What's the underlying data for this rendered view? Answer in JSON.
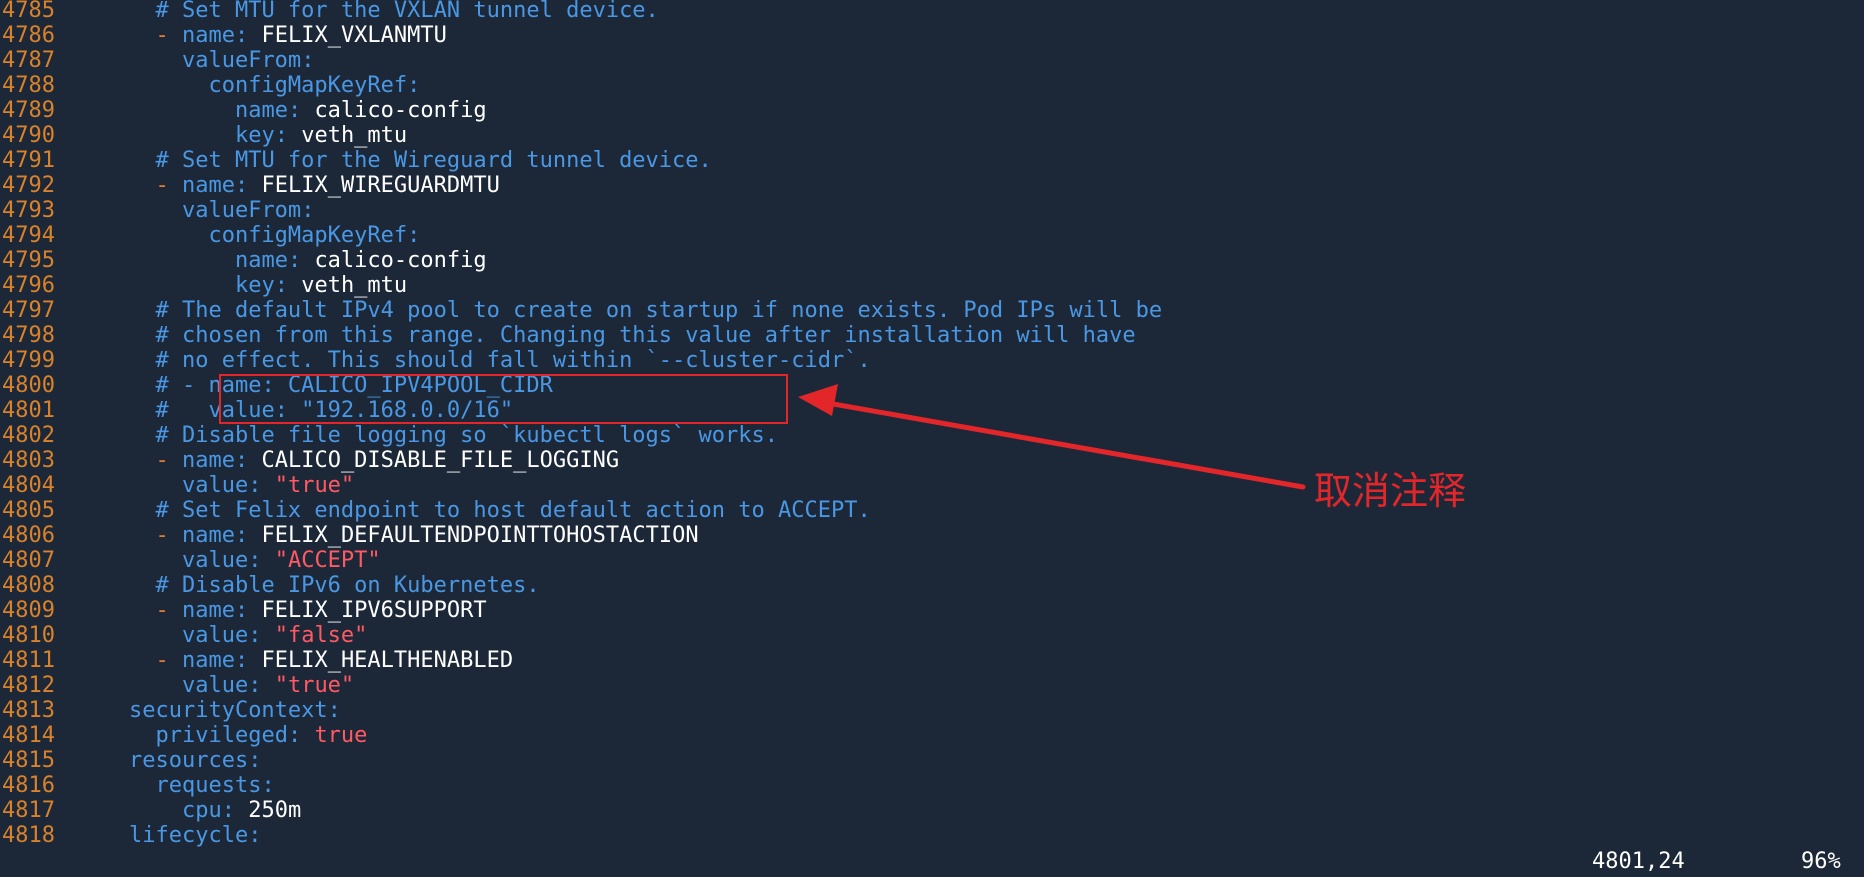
{
  "editor": {
    "lines": [
      {
        "num": "4785",
        "indent": "      ",
        "tokens": [
          {
            "t": "comment",
            "v": "# Set MTU for the VXLAN tunnel device."
          }
        ]
      },
      {
        "num": "4786",
        "indent": "      ",
        "tokens": [
          {
            "t": "dash",
            "v": "- "
          },
          {
            "t": "key",
            "v": "name"
          },
          {
            "t": "colon",
            "v": ": "
          },
          {
            "t": "plain",
            "v": "FELIX_VXLANMTU"
          }
        ]
      },
      {
        "num": "4787",
        "indent": "        ",
        "tokens": [
          {
            "t": "key",
            "v": "valueFrom"
          },
          {
            "t": "colon",
            "v": ":"
          }
        ]
      },
      {
        "num": "4788",
        "indent": "          ",
        "tokens": [
          {
            "t": "key",
            "v": "configMapKeyRef"
          },
          {
            "t": "colon",
            "v": ":"
          }
        ]
      },
      {
        "num": "4789",
        "indent": "            ",
        "tokens": [
          {
            "t": "key",
            "v": "name"
          },
          {
            "t": "colon",
            "v": ": "
          },
          {
            "t": "plain",
            "v": "calico-config"
          }
        ]
      },
      {
        "num": "4790",
        "indent": "            ",
        "tokens": [
          {
            "t": "key",
            "v": "key"
          },
          {
            "t": "colon",
            "v": ": "
          },
          {
            "t": "plain",
            "v": "veth_mtu"
          }
        ]
      },
      {
        "num": "4791",
        "indent": "      ",
        "tokens": [
          {
            "t": "comment",
            "v": "# Set MTU for the Wireguard tunnel device."
          }
        ]
      },
      {
        "num": "4792",
        "indent": "      ",
        "tokens": [
          {
            "t": "dash",
            "v": "- "
          },
          {
            "t": "key",
            "v": "name"
          },
          {
            "t": "colon",
            "v": ": "
          },
          {
            "t": "plain",
            "v": "FELIX_WIREGUARDMTU"
          }
        ]
      },
      {
        "num": "4793",
        "indent": "        ",
        "tokens": [
          {
            "t": "key",
            "v": "valueFrom"
          },
          {
            "t": "colon",
            "v": ":"
          }
        ]
      },
      {
        "num": "4794",
        "indent": "          ",
        "tokens": [
          {
            "t": "key",
            "v": "configMapKeyRef"
          },
          {
            "t": "colon",
            "v": ":"
          }
        ]
      },
      {
        "num": "4795",
        "indent": "            ",
        "tokens": [
          {
            "t": "key",
            "v": "name"
          },
          {
            "t": "colon",
            "v": ": "
          },
          {
            "t": "plain",
            "v": "calico-config"
          }
        ]
      },
      {
        "num": "4796",
        "indent": "            ",
        "tokens": [
          {
            "t": "key",
            "v": "key"
          },
          {
            "t": "colon",
            "v": ": "
          },
          {
            "t": "plain",
            "v": "veth_mtu"
          }
        ]
      },
      {
        "num": "4797",
        "indent": "      ",
        "tokens": [
          {
            "t": "comment",
            "v": "# The default IPv4 pool to create on startup if none exists. Pod IPs will be"
          }
        ]
      },
      {
        "num": "4798",
        "indent": "      ",
        "tokens": [
          {
            "t": "comment",
            "v": "# chosen from this range. Changing this value after installation will have"
          }
        ]
      },
      {
        "num": "4799",
        "indent": "      ",
        "tokens": [
          {
            "t": "comment",
            "v": "# no effect. This should fall within `--cluster-cidr`."
          }
        ]
      },
      {
        "num": "4800",
        "indent": "      ",
        "tokens": [
          {
            "t": "comment",
            "v": "# - name: CALICO_IPV4POOL_CIDR"
          }
        ]
      },
      {
        "num": "4801",
        "indent": "      ",
        "tokens": [
          {
            "t": "comment",
            "v": "#   value: \"192.168.0.0/16\""
          }
        ]
      },
      {
        "num": "4802",
        "indent": "      ",
        "tokens": [
          {
            "t": "comment",
            "v": "# Disable file logging so `kubectl logs` works."
          }
        ]
      },
      {
        "num": "4803",
        "indent": "      ",
        "tokens": [
          {
            "t": "dash",
            "v": "- "
          },
          {
            "t": "key",
            "v": "name"
          },
          {
            "t": "colon",
            "v": ": "
          },
          {
            "t": "plain",
            "v": "CALICO_DISABLE_FILE_LOGGING"
          }
        ]
      },
      {
        "num": "4804",
        "indent": "        ",
        "tokens": [
          {
            "t": "key",
            "v": "value"
          },
          {
            "t": "colon",
            "v": ": "
          },
          {
            "t": "string",
            "v": "\"true\""
          }
        ]
      },
      {
        "num": "4805",
        "indent": "      ",
        "tokens": [
          {
            "t": "comment",
            "v": "# Set Felix endpoint to host default action to ACCEPT."
          }
        ]
      },
      {
        "num": "4806",
        "indent": "      ",
        "tokens": [
          {
            "t": "dash",
            "v": "- "
          },
          {
            "t": "key",
            "v": "name"
          },
          {
            "t": "colon",
            "v": ": "
          },
          {
            "t": "plain",
            "v": "FELIX_DEFAULTENDPOINTTOHOSTACTION"
          }
        ]
      },
      {
        "num": "4807",
        "indent": "        ",
        "tokens": [
          {
            "t": "key",
            "v": "value"
          },
          {
            "t": "colon",
            "v": ": "
          },
          {
            "t": "string",
            "v": "\"ACCEPT\""
          }
        ]
      },
      {
        "num": "4808",
        "indent": "      ",
        "tokens": [
          {
            "t": "comment",
            "v": "# Disable IPv6 on Kubernetes."
          }
        ]
      },
      {
        "num": "4809",
        "indent": "      ",
        "tokens": [
          {
            "t": "dash",
            "v": "- "
          },
          {
            "t": "key",
            "v": "name"
          },
          {
            "t": "colon",
            "v": ": "
          },
          {
            "t": "plain",
            "v": "FELIX_IPV6SUPPORT"
          }
        ]
      },
      {
        "num": "4810",
        "indent": "        ",
        "tokens": [
          {
            "t": "key",
            "v": "value"
          },
          {
            "t": "colon",
            "v": ": "
          },
          {
            "t": "string",
            "v": "\"false\""
          }
        ]
      },
      {
        "num": "4811",
        "indent": "      ",
        "tokens": [
          {
            "t": "dash",
            "v": "- "
          },
          {
            "t": "key",
            "v": "name"
          },
          {
            "t": "colon",
            "v": ": "
          },
          {
            "t": "plain",
            "v": "FELIX_HEALTHENABLED"
          }
        ]
      },
      {
        "num": "4812",
        "indent": "        ",
        "tokens": [
          {
            "t": "key",
            "v": "value"
          },
          {
            "t": "colon",
            "v": ": "
          },
          {
            "t": "string",
            "v": "\"true\""
          }
        ]
      },
      {
        "num": "4813",
        "indent": "    ",
        "tokens": [
          {
            "t": "key",
            "v": "securityContext"
          },
          {
            "t": "colon",
            "v": ":"
          }
        ]
      },
      {
        "num": "4814",
        "indent": "      ",
        "tokens": [
          {
            "t": "key",
            "v": "privileged"
          },
          {
            "t": "colon",
            "v": ": "
          },
          {
            "t": "bool",
            "v": "true"
          }
        ]
      },
      {
        "num": "4815",
        "indent": "    ",
        "tokens": [
          {
            "t": "key",
            "v": "resources"
          },
          {
            "t": "colon",
            "v": ":"
          }
        ]
      },
      {
        "num": "4816",
        "indent": "      ",
        "tokens": [
          {
            "t": "key",
            "v": "requests"
          },
          {
            "t": "colon",
            "v": ":"
          }
        ]
      },
      {
        "num": "4817",
        "indent": "        ",
        "tokens": [
          {
            "t": "key",
            "v": "cpu"
          },
          {
            "t": "colon",
            "v": ": "
          },
          {
            "t": "plain",
            "v": "250m"
          }
        ]
      },
      {
        "num": "4818",
        "indent": "    ",
        "tokens": [
          {
            "t": "key",
            "v": "lifecycle"
          },
          {
            "t": "colon",
            "v": ":"
          }
        ]
      }
    ]
  },
  "status": {
    "cursor_position": "4801,24",
    "scroll_percent": "96%"
  },
  "annotation": {
    "label": "取消注释",
    "color": "#e3262a"
  },
  "colors": {
    "background": "#1c2838",
    "line_number": "#d9822b",
    "comment": "#4a97e4",
    "key": "#4a97e4",
    "dash": "#e07a2e",
    "plain": "#ffffff",
    "string": "#ff5a63"
  }
}
